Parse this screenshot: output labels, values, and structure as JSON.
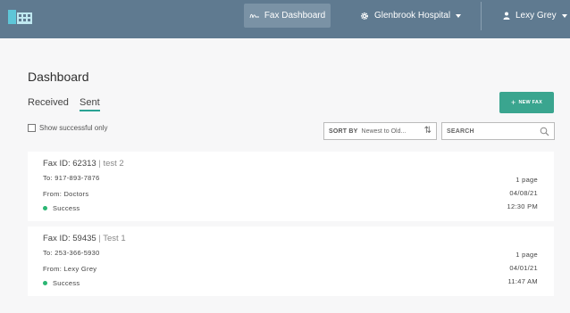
{
  "header": {
    "fax_dashboard_label": "Fax Dashboard",
    "hospital_label": "Glenbrook Hospital",
    "user_label": "Lexy Grey"
  },
  "page": {
    "title": "Dashboard",
    "tabs": [
      {
        "label": "Received",
        "active": false
      },
      {
        "label": "Sent",
        "active": true
      }
    ],
    "new_fax_label": "NEW FAX",
    "show_successful_label": "Show successful only",
    "sort": {
      "label": "SORT BY",
      "value": "Newest to Old..."
    },
    "search": {
      "placeholder": "SEARCH"
    }
  },
  "faxes": [
    {
      "id_label": "Fax ID:",
      "id": "62313",
      "separator": "|",
      "name": "test 2",
      "to": "To:  917-893-7876",
      "from": "From:  Doctors",
      "status": "Success",
      "pages": "1 page",
      "date": "04/08/21",
      "time": "12:30 PM"
    },
    {
      "id_label": "Fax ID:",
      "id": "59435",
      "separator": "|",
      "name": "Test 1",
      "to": "To:  253-366-5930",
      "from": "From:  Lexy Grey",
      "status": "Success",
      "pages": "1 page",
      "date": "04/01/21",
      "time": "11:47 AM"
    }
  ],
  "colors": {
    "topbar": "#5f7a90",
    "accent": "#3aa58f",
    "success": "#2bb673"
  }
}
